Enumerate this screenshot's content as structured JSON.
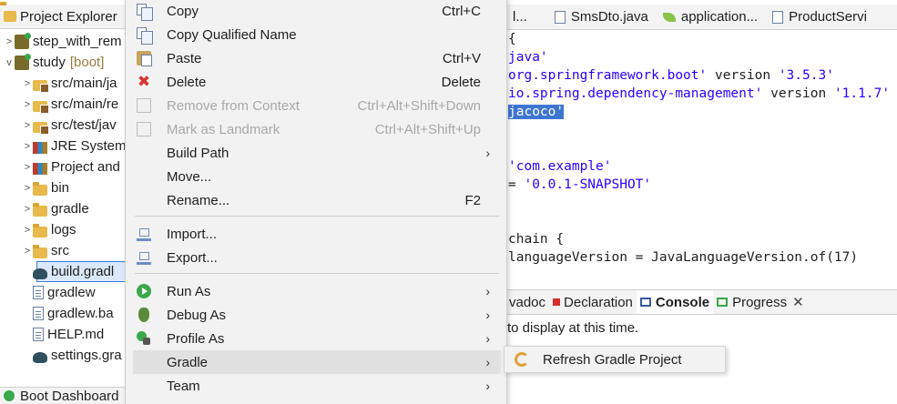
{
  "explorer": {
    "tab_label": "Project Explorer",
    "items": [
      {
        "label": "step_with_rem",
        "twisty": ">",
        "icon": "project-icon"
      },
      {
        "label": "study",
        "suffix": "[boot]",
        "twisty": "v",
        "icon": "project-icon"
      },
      {
        "label": "src/main/ja",
        "twisty": ">",
        "icon": "source-folder-icon"
      },
      {
        "label": "src/main/re",
        "twisty": ">",
        "icon": "source-folder-icon"
      },
      {
        "label": "src/test/jav",
        "twisty": ">",
        "icon": "source-folder-icon"
      },
      {
        "label": "JRE System",
        "twisty": ">",
        "icon": "library-icon"
      },
      {
        "label": "Project and",
        "twisty": ">",
        "icon": "library-icon"
      },
      {
        "label": "bin",
        "twisty": ">",
        "icon": "folder-icon"
      },
      {
        "label": "gradle",
        "twisty": ">",
        "icon": "folder-icon"
      },
      {
        "label": "logs",
        "twisty": ">",
        "icon": "folder-icon"
      },
      {
        "label": "src",
        "twisty": ">",
        "icon": "folder-icon"
      },
      {
        "label": "build.gradl",
        "twisty": "",
        "icon": "gradle-file-icon"
      },
      {
        "label": "gradlew",
        "twisty": "",
        "icon": "file-icon"
      },
      {
        "label": "gradlew.ba",
        "twisty": "",
        "icon": "file-icon"
      },
      {
        "label": "HELP.md",
        "twisty": "",
        "icon": "file-icon"
      },
      {
        "label": "settings.gra",
        "twisty": "",
        "icon": "gradle-elephant-icon"
      }
    ],
    "boot_dashboard_label": "Boot Dashboard"
  },
  "editor": {
    "tabs": [
      {
        "label": "l..."
      },
      {
        "label": "SmsDto.java"
      },
      {
        "label": "application..."
      },
      {
        "label": "ProductServi"
      }
    ],
    "code_lines": [
      {
        "pre": "{",
        "str": "",
        "post": "",
        "hl": ""
      },
      {
        "pre": "",
        "str": "java'",
        "post": "",
        "hl": ""
      },
      {
        "pre": "",
        "str": "org.springframework.boot'",
        "post": " version ",
        "str2": "'3.5.3'",
        "hl": ""
      },
      {
        "pre": "",
        "str": "io.spring.dependency-management'",
        "post": " version ",
        "str2": "'1.1.7'",
        "hl": ""
      },
      {
        "pre": "",
        "str": "",
        "post": "",
        "hl": "jacoco'"
      },
      {
        "pre": "",
        "str": "",
        "post": "",
        "hl": ""
      },
      {
        "pre": "",
        "str": "",
        "post": "",
        "hl": ""
      },
      {
        "pre": "",
        "str": "'com.example'",
        "post": "",
        "hl": ""
      },
      {
        "pre": "= ",
        "str": "'0.0.1-SNAPSHOT'",
        "post": "",
        "hl": ""
      },
      {
        "pre": "",
        "str": "",
        "post": "",
        "hl": ""
      },
      {
        "pre": "",
        "str": "",
        "post": "",
        "hl": ""
      },
      {
        "pre": "chain {",
        "str": "",
        "post": "",
        "hl": ""
      },
      {
        "pre": "languageVersion = JavaLanguageVersion.of(17)",
        "str": "",
        "post": "",
        "hl": ""
      }
    ]
  },
  "bottom_panel": {
    "tabs": [
      {
        "label": "vadoc",
        "kind": "plain"
      },
      {
        "label": "Declaration",
        "kind": "declaration"
      },
      {
        "label": "Console",
        "kind": "console",
        "active": true
      },
      {
        "label": "Progress",
        "kind": "progress",
        "close": "✕"
      }
    ],
    "message": "to display at this time."
  },
  "context_menu": {
    "items": [
      {
        "label": "Copy",
        "shortcut": "Ctrl+C",
        "icon": "copy-icon",
        "enabled": true
      },
      {
        "label": "Copy Qualified Name",
        "shortcut": "",
        "icon": "copy-icon",
        "enabled": true
      },
      {
        "label": "Paste",
        "shortcut": "Ctrl+V",
        "icon": "paste-icon",
        "enabled": true
      },
      {
        "label": "Delete",
        "shortcut": "Delete",
        "icon": "delete-icon",
        "enabled": true
      },
      {
        "label": "Remove from Context",
        "shortcut": "Ctrl+Alt+Shift+Down",
        "icon": "remove-context-icon",
        "enabled": false
      },
      {
        "label": "Mark as Landmark",
        "shortcut": "Ctrl+Alt+Shift+Up",
        "icon": "landmark-icon",
        "enabled": false
      },
      {
        "label": "Build Path",
        "shortcut": "",
        "icon": "",
        "enabled": true,
        "submenu": true
      },
      {
        "label": "Move...",
        "shortcut": "",
        "icon": "",
        "enabled": true
      },
      {
        "label": "Rename...",
        "shortcut": "F2",
        "icon": "",
        "enabled": true
      },
      {
        "label": "Import...",
        "shortcut": "",
        "icon": "import-icon",
        "enabled": true
      },
      {
        "label": "Export...",
        "shortcut": "",
        "icon": "export-icon",
        "enabled": true
      },
      {
        "label": "Run As",
        "shortcut": "",
        "icon": "run-icon",
        "enabled": true,
        "submenu": true
      },
      {
        "label": "Debug As",
        "shortcut": "",
        "icon": "debug-icon",
        "enabled": true,
        "submenu": true
      },
      {
        "label": "Profile As",
        "shortcut": "",
        "icon": "profile-icon",
        "enabled": true,
        "submenu": true
      },
      {
        "label": "Gradle",
        "shortcut": "",
        "icon": "",
        "enabled": true,
        "submenu": true,
        "hover": true
      },
      {
        "label": "Team",
        "shortcut": "",
        "icon": "",
        "enabled": true,
        "submenu": true
      }
    ],
    "submenu_arrow": "›"
  },
  "gradle_submenu": {
    "items": [
      {
        "label": "Refresh Gradle Project",
        "icon": "refresh-gradle-icon"
      }
    ]
  }
}
